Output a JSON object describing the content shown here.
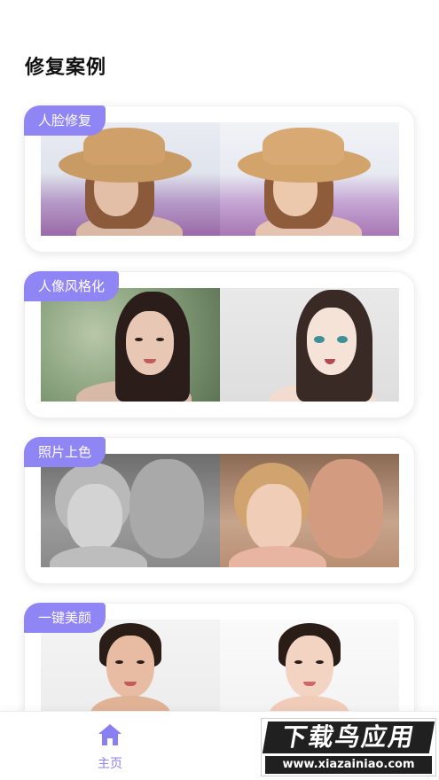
{
  "page": {
    "section_title": "修复案例"
  },
  "cases": [
    {
      "tag": "人脸修复"
    },
    {
      "tag": "人像风格化"
    },
    {
      "tag": "照片上色"
    },
    {
      "tag": "一键美颜"
    }
  ],
  "bottom_nav": {
    "home_label": "主页",
    "accent": "#8a7ff2"
  },
  "watermark": {
    "main": "下载鸟应用",
    "url": "www.xiazainiao.com"
  },
  "colors": {
    "tag_bg": "#9085f4",
    "title": "#111111"
  }
}
